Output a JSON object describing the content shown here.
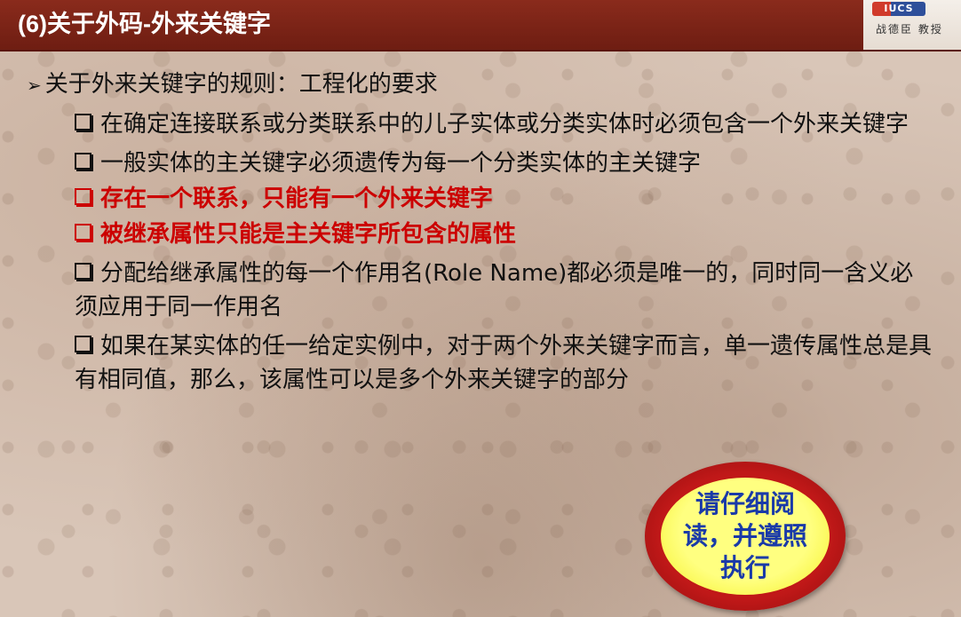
{
  "header": {
    "title": "(6)关于外码-外来关键字",
    "logo_mark": "IUCS",
    "logo_text": "战德臣 教授"
  },
  "content": {
    "main_bullet": "关于外来关键字的规则：工程化的要求",
    "items": [
      {
        "text": "在确定连接联系或分类联系中的儿子实体或分类实体时必须包含一个外来关键字",
        "highlight": false
      },
      {
        "text": "一般实体的主关键字必须遗传为每一个分类实体的主关键字",
        "highlight": false
      },
      {
        "text": "存在一个联系，只能有一个外来关键字",
        "highlight": true
      },
      {
        "text": "被继承属性只能是主关键字所包含的属性",
        "highlight": true
      },
      {
        "text": "分配给继承属性的每一个作用名(Role Name)都必须是唯一的，同时同一含义必须应用于同一作用名",
        "highlight": false
      },
      {
        "text": "如果在某实体的任一给定实例中，对于两个外来关键字而言，单一遗传属性总是具有相同值，那么，该属性可以是多个外来关键字的部分",
        "highlight": false
      }
    ]
  },
  "badge": {
    "text": "请仔细阅读，并遵照执行"
  },
  "colors": {
    "header_bg": "#7a2416",
    "highlight": "#cc0000",
    "badge_outer": "#c01818",
    "badge_inner": "#ffff66",
    "badge_text": "#1a3aa8"
  }
}
